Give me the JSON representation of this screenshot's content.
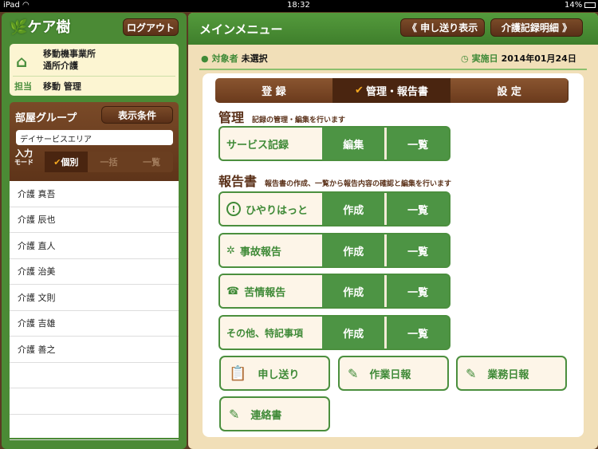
{
  "status_bar": {
    "device": "iPad",
    "time": "18:32",
    "battery": "14%"
  },
  "sidebar": {
    "logo_text": "ケア樹",
    "logout_label": "ログアウト",
    "facility_line1": "移動機事業所",
    "facility_line2": "通所介護",
    "staff_label": "担当",
    "staff_name": "移動 管理",
    "room_group_label": "部屋グループ",
    "display_conditions_label": "表示条件",
    "room_group_value": "デイサービスエリア",
    "input_mode_label_1": "入力",
    "input_mode_label_2": "モード",
    "modes": [
      "個別",
      "一括",
      "一覧"
    ],
    "residents": [
      "介護 真吾",
      "介護 辰也",
      "介護 直人",
      "介護 治美",
      "介護 文則",
      "介護 吉雄",
      "介護 善之",
      "",
      "",
      ""
    ]
  },
  "header": {
    "title": "メインメニュー",
    "prev_label": "申し送り表示",
    "next_label": "介護記録明細"
  },
  "info": {
    "subject_label": "対象者",
    "subject_value": "未選択",
    "date_label": "実施日",
    "date_value": "2014年01月24日"
  },
  "tabs": [
    "登 録",
    "管理・報告書",
    "設 定"
  ],
  "management": {
    "heading": "管理",
    "desc": "記録の管理・編集を行います",
    "service_record": "サービス記録",
    "edit": "編集",
    "list": "一覧"
  },
  "reports": {
    "heading": "報告書",
    "desc": "報告書の作成、一覧から報告内容の確認と編集を行います",
    "items": [
      {
        "label": "ひやりはっと",
        "create": "作成",
        "list": "一覧"
      },
      {
        "label": "事故報告",
        "create": "作成",
        "list": "一覧"
      },
      {
        "label": "苦情報告",
        "create": "作成",
        "list": "一覧"
      },
      {
        "label": "その他、特記事項",
        "create": "作成",
        "list": "一覧"
      }
    ]
  },
  "extras": [
    "申し送り",
    "作業日報",
    "業務日報",
    "連絡書"
  ],
  "colors": {
    "green": "#4b8f3e",
    "brown": "#5a3018",
    "cream": "#fdf5e8"
  }
}
